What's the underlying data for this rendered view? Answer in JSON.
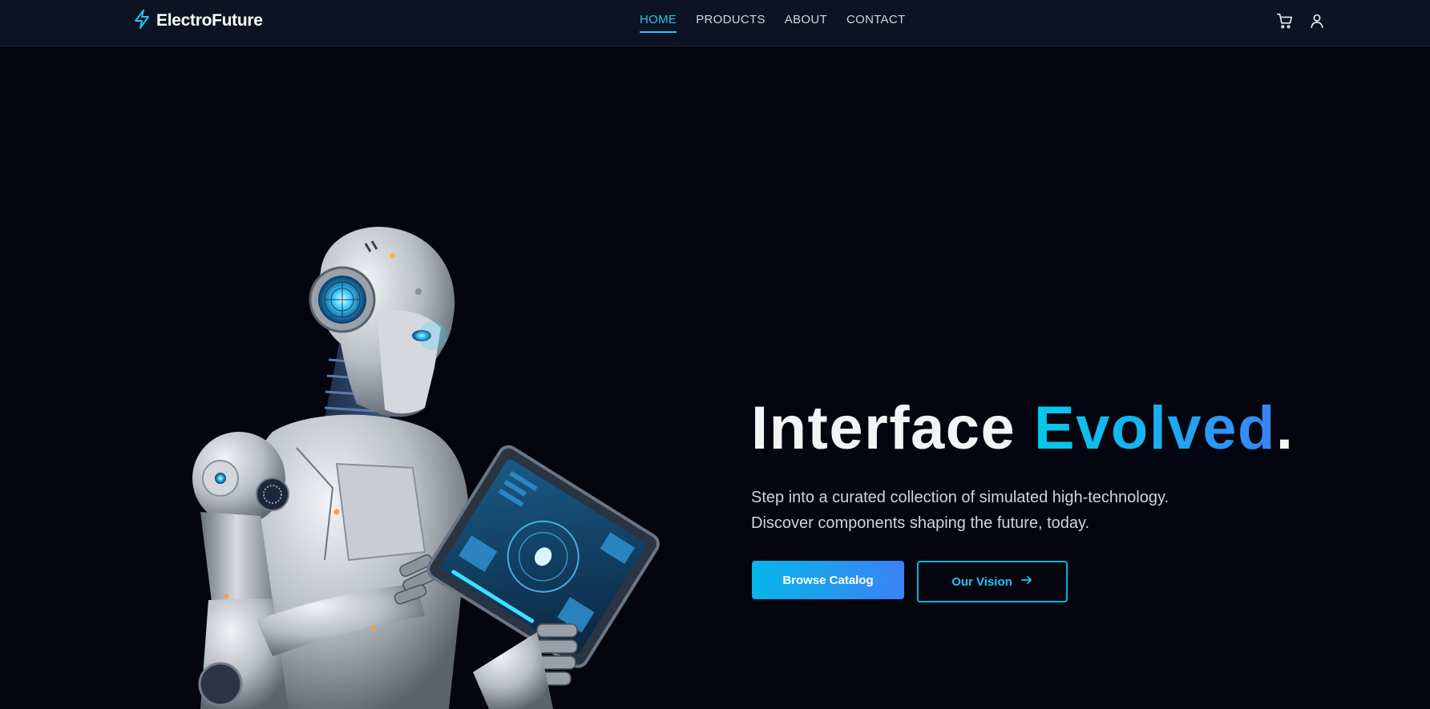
{
  "brand": {
    "name": "ElectroFuture",
    "icon": "lightning-bolt-icon"
  },
  "nav": {
    "links": [
      {
        "label": "HOME",
        "active": true
      },
      {
        "label": "PRODUCTS",
        "active": false
      },
      {
        "label": "ABOUT",
        "active": false
      },
      {
        "label": "CONTACT",
        "active": false
      }
    ],
    "icons": [
      "cart-icon",
      "user-icon"
    ]
  },
  "hero": {
    "title_part1": "Interface ",
    "title_accent": "Evolved",
    "title_period": ".",
    "subtitle_line1": "Step into a curated collection of simulated high-technology.",
    "subtitle_line2": "Discover components shaping the future, today.",
    "primary_button": "Browse Catalog",
    "secondary_button": "Our Vision",
    "secondary_button_icon": "arrow-right-icon",
    "illustration": "robot-with-tablet"
  },
  "colors": {
    "background": "#04050f",
    "navbar": "#0d1322",
    "accent_cyan": "#06c8ea",
    "accent_blue": "#3b82f6"
  }
}
